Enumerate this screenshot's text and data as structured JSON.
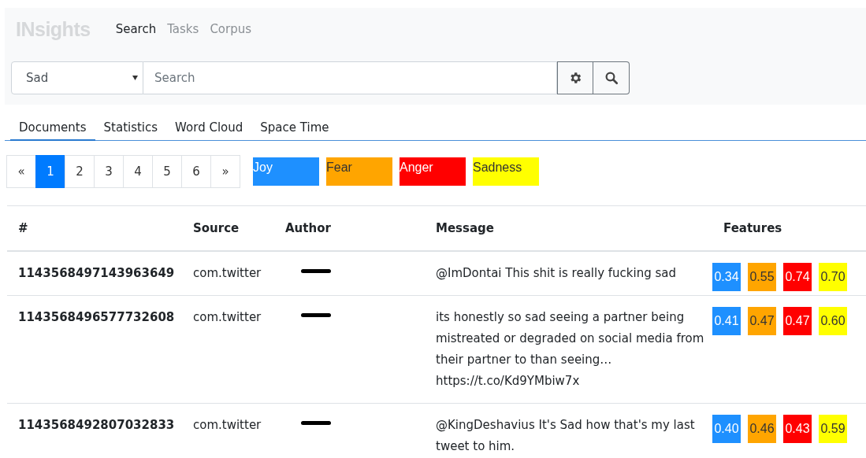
{
  "navbar": {
    "logo": "INsights",
    "links": [
      {
        "label": "Search",
        "selected": true
      },
      {
        "label": "Tasks",
        "selected": false
      },
      {
        "label": "Corpus",
        "selected": false
      }
    ]
  },
  "search": {
    "select_value": "Sad",
    "placeholder": "Search"
  },
  "tabs": [
    {
      "label": "Documents",
      "selected": true
    },
    {
      "label": "Statistics",
      "selected": false
    },
    {
      "label": "Word Cloud",
      "selected": false
    },
    {
      "label": "Space Time",
      "selected": false
    }
  ],
  "pagination": [
    {
      "label": "«",
      "selected": false
    },
    {
      "label": "1",
      "selected": true
    },
    {
      "label": "2",
      "selected": false
    },
    {
      "label": "3",
      "selected": false
    },
    {
      "label": "4",
      "selected": false
    },
    {
      "label": "5",
      "selected": false
    },
    {
      "label": "6",
      "selected": false
    },
    {
      "label": "»",
      "selected": false
    }
  ],
  "legend": [
    {
      "label": "Joy",
      "color": "#1e90ff"
    },
    {
      "label": "Fear",
      "color": "#ffa500"
    },
    {
      "label": "Anger",
      "color": "#ff0000"
    },
    {
      "label": "Sadness",
      "color": "#ffff00"
    }
  ],
  "table": {
    "columns": [
      "#",
      "Source",
      "Author",
      "Message",
      "Features"
    ],
    "rows": [
      {
        "id": "1143568497143963649",
        "source": "com.twitter",
        "message": "@ImDontai This shit is really fucking sad",
        "features": [
          "0.34",
          "0.55",
          "0.74",
          "0.70"
        ]
      },
      {
        "id": "1143568496577732608",
        "source": "com.twitter",
        "message": "its honestly so sad seeing a partner being mistreated or degraded on social media from their partner to than seeing… https://t.co/Kd9YMbiw7x",
        "features": [
          "0.41",
          "0.47",
          "0.47",
          "0.60"
        ]
      },
      {
        "id": "1143568492807032833",
        "source": "com.twitter",
        "message": "@KingDeshavius It's Sad how that's my last tweet to him.",
        "features": [
          "0.40",
          "0.46",
          "0.43",
          "0.59"
        ]
      }
    ]
  }
}
